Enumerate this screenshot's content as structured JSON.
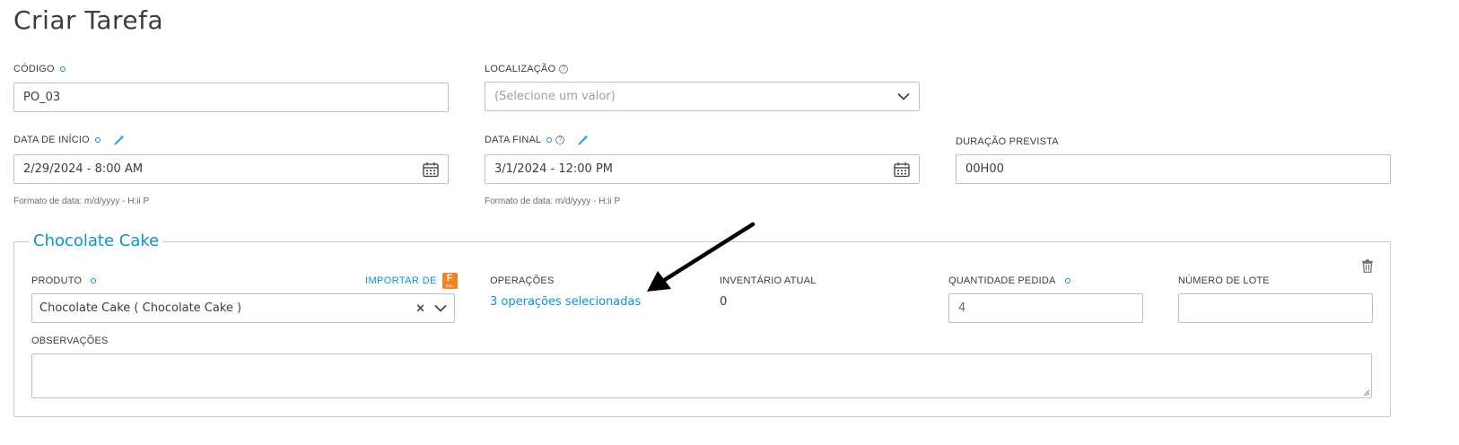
{
  "page": {
    "title": "Criar Tarefa"
  },
  "form": {
    "codigo": {
      "label": "CÓDIGO",
      "value": "PO_03"
    },
    "localizacao": {
      "label": "LOCALIZAÇÃO",
      "placeholder": "(Selecione um valor)"
    },
    "data_inicio": {
      "label": "DATA DE INÍCIO",
      "value": "2/29/2024 - 8:00 AM",
      "hint": "Formato de data: m/d/yyyy - H:ii P"
    },
    "data_final": {
      "label": "DATA FINAL",
      "value": "3/1/2024 - 12:00 PM",
      "hint": "Formato de data: m/d/yyyy - H:ii P"
    },
    "duracao": {
      "label": "DURAÇÃO PREVISTA",
      "value": "00H00"
    }
  },
  "product_section": {
    "title": "Chocolate Cake",
    "produto": {
      "label": "PRODUTO",
      "value": "Chocolate Cake ( Chocolate Cake )",
      "import_label": "IMPORTAR DE",
      "import_badge": "F"
    },
    "operacoes": {
      "label": "OPERAÇÕES",
      "link": "3 operações selecionadas"
    },
    "inventario": {
      "label": "INVENTÁRIO ATUAL",
      "value": "0"
    },
    "quantidade": {
      "label": "QUANTIDADE PEDIDA",
      "value": "4"
    },
    "lote": {
      "label": "NÚMERO DE LOTE",
      "value": ""
    },
    "observacoes": {
      "label": "OBSERVAÇÕES",
      "value": ""
    }
  },
  "colors": {
    "accent": "#0696d7",
    "border": "#bfbfbf",
    "text": "#3c3c3c",
    "fusion": "#f58220"
  },
  "icons": [
    "required-dot-icon",
    "help-icon",
    "wand-icon",
    "calendar-icon",
    "chevron-down-icon",
    "clear-icon",
    "trash-icon",
    "fusion-logo-icon",
    "annotation-arrow"
  ]
}
